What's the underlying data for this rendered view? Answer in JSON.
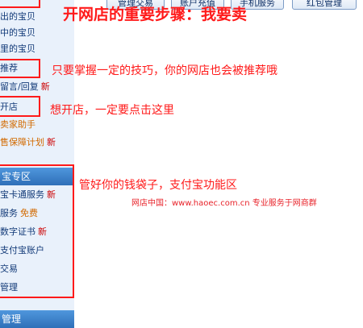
{
  "top_tabs": [
    "管理交易",
    "账户充值",
    "手机服务",
    "红包管理"
  ],
  "sidebar": {
    "items": [
      {
        "label": "出的宝贝"
      },
      {
        "label": "中的宝贝"
      },
      {
        "label": "里的宝贝"
      },
      {
        "label": "推荐"
      },
      {
        "label": "留言/回复",
        "tag": "新"
      },
      {
        "label": "开店"
      },
      {
        "label": "卖家助手"
      },
      {
        "label": "售保障计划",
        "tag": "新"
      }
    ],
    "alipay_section": {
      "header": "宝专区",
      "items": [
        {
          "label": "宝卡通服务",
          "tag": "新"
        },
        {
          "label": "服务",
          "tag": "免费"
        },
        {
          "label": "数字证书",
          "tag": "新"
        },
        {
          "label": "支付宝账户"
        },
        {
          "label": "交易"
        },
        {
          "label": "管理"
        }
      ]
    },
    "bottom_header": "管理"
  },
  "annotations": {
    "main_title": "开网店的重要步骤：我要卖",
    "recommend": "只要掌握一定的技巧，你的网店也会被推荐哦",
    "open_shop": "想开店，一定要点击这里",
    "wallet": "管好你的钱袋子，支付宝功能区",
    "site_line": "网店中国：www.haoec.com.cn 专业服务于网商群"
  },
  "colors": {
    "annotation_red": "#ff1a1a",
    "sidebar_bg": "#e9f1fb",
    "header_blue": "#2f6fb8",
    "link_blue": "#123a78",
    "orange": "#d26a00"
  }
}
